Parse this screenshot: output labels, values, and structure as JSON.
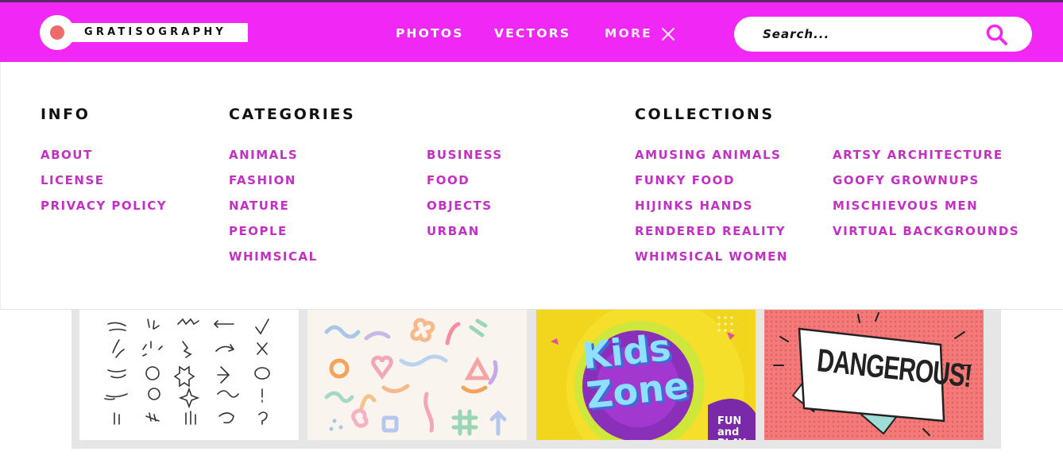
{
  "header": {
    "logo_text": "GRATISOGRAPHY",
    "nav": {
      "photos": "PHOTOS",
      "vectors": "VECTORS",
      "more": "MORE"
    },
    "search": {
      "placeholder": "Search..."
    }
  },
  "menu": {
    "info": {
      "title": "INFO",
      "items": [
        "ABOUT",
        "LICENSE",
        "PRIVACY POLICY"
      ]
    },
    "categories": {
      "title": "CATEGORIES",
      "items": [
        "ANIMALS",
        "FASHION",
        "NATURE",
        "PEOPLE",
        "WHIMSICAL",
        "BUSINESS",
        "FOOD",
        "OBJECTS",
        "URBAN"
      ]
    },
    "collections": {
      "title": "COLLECTIONS",
      "items": [
        "AMUSING ANIMALS",
        "FUNKY FOOD",
        "HIJINKS HANDS",
        "RENDERED REALITY",
        "WHIMSICAL WOMEN",
        "ARTSY ARCHITECTURE",
        "GOOFY GROWNUPS",
        "MISCHIEVOUS MEN",
        "VIRTUAL BACKGROUNDS"
      ]
    }
  },
  "gallery": {
    "thumb3_title": "Kids Zone",
    "thumb3_sub": "FUN and PLAY",
    "thumb4_title": "DANGEROUS!"
  },
  "colors": {
    "header_bg": "#f128f5",
    "link": "#c330c4",
    "logo_dot": "#ee6b6b"
  }
}
